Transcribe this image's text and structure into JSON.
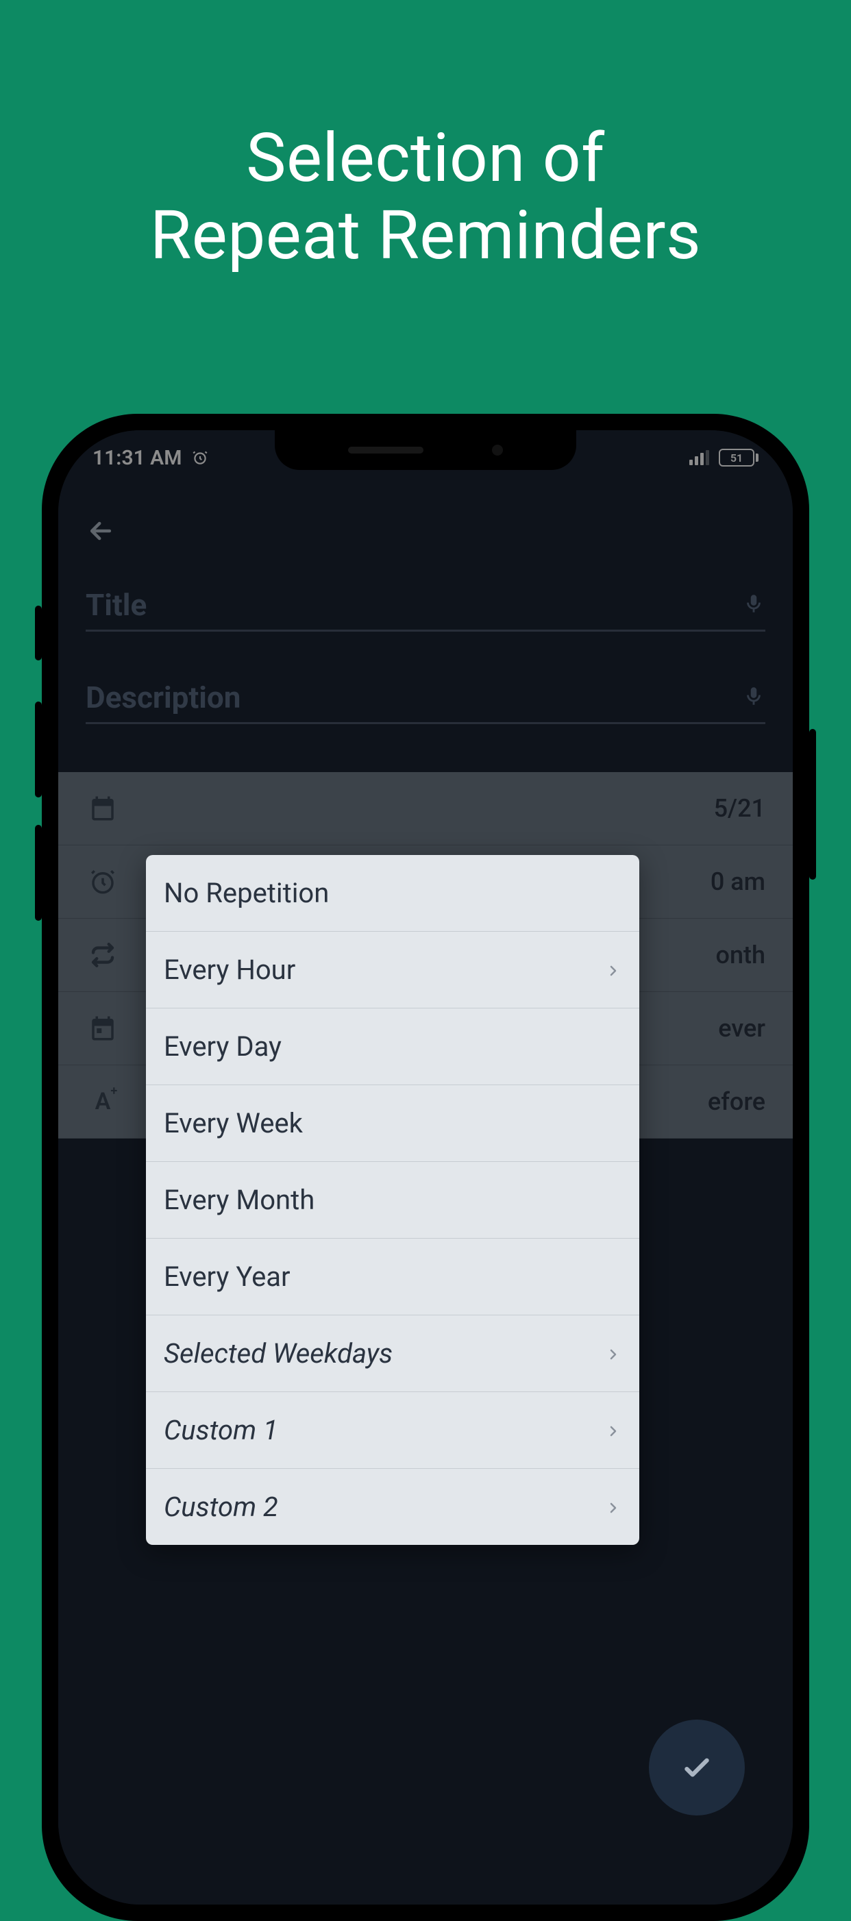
{
  "promo": {
    "line1": "Selection of",
    "line2": "Repeat Reminders"
  },
  "statusbar": {
    "time": "11:31 AM",
    "battery": "51"
  },
  "form": {
    "title_placeholder": "Title",
    "description_placeholder": "Description"
  },
  "rows": {
    "date": "5/21",
    "time": "0 am",
    "repeat": "onth",
    "until": "ever",
    "advance": "efore"
  },
  "popup": {
    "items": [
      {
        "label": "No Repetition",
        "chevron": false,
        "italic": false
      },
      {
        "label": "Every Hour",
        "chevron": true,
        "italic": false
      },
      {
        "label": "Every Day",
        "chevron": false,
        "italic": false
      },
      {
        "label": "Every Week",
        "chevron": false,
        "italic": false
      },
      {
        "label": "Every Month",
        "chevron": false,
        "italic": false
      },
      {
        "label": "Every Year",
        "chevron": false,
        "italic": false
      },
      {
        "label": "Selected Weekdays",
        "chevron": true,
        "italic": true
      },
      {
        "label": "Custom 1",
        "chevron": true,
        "italic": true
      },
      {
        "label": "Custom 2",
        "chevron": true,
        "italic": true
      }
    ]
  }
}
